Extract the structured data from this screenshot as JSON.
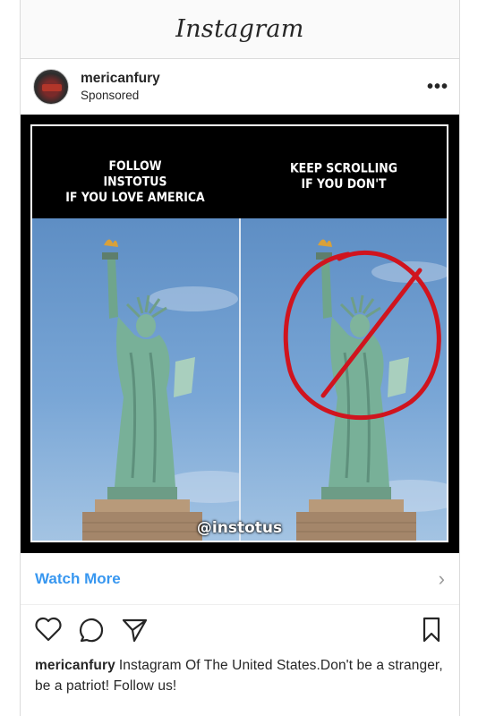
{
  "app": {
    "title": "Instagram"
  },
  "post": {
    "username": "mericanfury",
    "sponsored_label": "Sponsored",
    "more_icon": "ellipsis-icon",
    "image": {
      "left_caption": "FOLLOW\nINSTOTUS\nIF YOU LOVE AMERICA",
      "right_caption": "KEEP SCROLLING\nIF YOU DON'T",
      "watermark": "@instotus"
    },
    "cta_label": "Watch More",
    "cta_icon": "chevron-right-icon",
    "caption_username": "mericanfury",
    "caption_text": "Instagram Of The United States.Don't be a stranger, be a patriot! Follow us!"
  },
  "colors": {
    "link": "#3897f0",
    "slash": "#d0141e",
    "statue": "#7fb9a0"
  }
}
